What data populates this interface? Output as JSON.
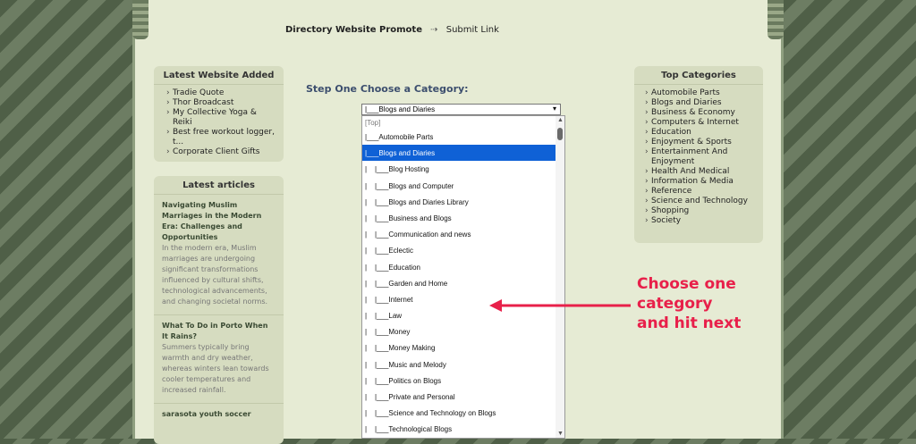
{
  "breadcrumb": {
    "current": "Directory Website Promote",
    "separator": "⇢",
    "link": "Submit Link"
  },
  "latest_websites": {
    "title": "Latest Website Added",
    "items": [
      "Tradie Quote",
      "Thor Broadcast",
      "My Collective Yoga & Reiki",
      "Best free workout logger, t...",
      "Corporate Client Gifts"
    ]
  },
  "latest_articles": {
    "title": "Latest articles",
    "items": [
      {
        "title": "Navigating Muslim Marriages in the Modern Era: Challenges and Opportunities",
        "summary": "In the modern era, Muslim marriages are undergoing significant transformations influenced by cultural shifts, technological advancements, and changing societal norms."
      },
      {
        "title": "What To Do in Porto When It Rains?",
        "summary": "Summers typically bring warmth and dry weather, whereas winters lean towards cooler temperatures and increased rainfall."
      },
      {
        "title": "sarasota youth soccer",
        "summary": ""
      }
    ]
  },
  "step": {
    "title": "Step One Choose a Category:"
  },
  "category_select": {
    "selected": "|___Blogs and Diaries",
    "options": [
      "[Top]",
      "|___Automobile Parts",
      "|___Blogs and Diaries",
      "|    |___Blog Hosting",
      "|    |___Blogs and Computer",
      "|    |___Blogs and Diaries Library",
      "|    |___Business and Blogs",
      "|    |___Communication and news",
      "|    |___Eclectic",
      "|    |___Education",
      "|    |___Garden and Home",
      "|    |___Internet",
      "|    |___Law",
      "|    |___Money",
      "|    |___Money Making",
      "|    |___Music and Melody",
      "|    |___Politics on Blogs",
      "|    |___Private and Personal",
      "|    |___Science and Technology on Blogs",
      "|    |___Technological Blogs"
    ],
    "selected_index": 2
  },
  "top_categories": {
    "title": "Top Categories",
    "items": [
      "Automobile Parts",
      "Blogs and Diaries",
      "Business & Economy",
      "Computers & Internet",
      "Education",
      "Enjoyment & Sports",
      "Entertainment And Enjoyment",
      "Health And Medical",
      "Information & Media",
      "Reference",
      "Science and Technology",
      "Shopping",
      "Society"
    ]
  },
  "annotation": {
    "lines": [
      "Choose one",
      "category",
      "and hit next"
    ],
    "color": "#e8204a"
  }
}
